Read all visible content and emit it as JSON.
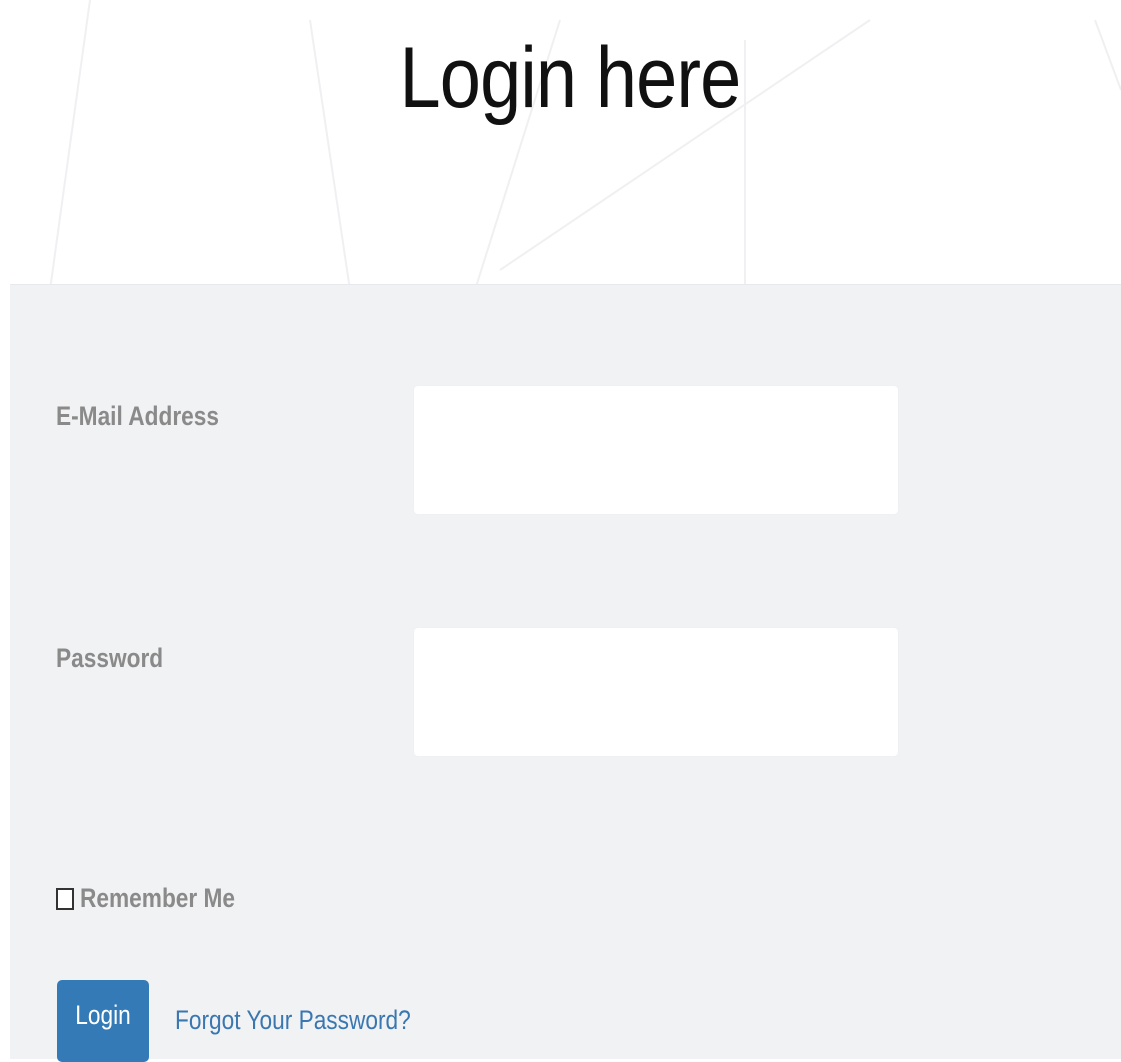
{
  "page": {
    "title": "Login here"
  },
  "form": {
    "email_label": "E-Mail Address",
    "email_value": "",
    "password_label": "Password",
    "password_value": "",
    "remember_label": "Remember Me",
    "remember_checked": false,
    "login_label": "Login",
    "forgot_label": "Forgot Your Password?"
  },
  "colors": {
    "panel_background": "#f1f2f4",
    "button_primary": "#337ab7",
    "link": "#3a77b0",
    "label_text": "#8a8a8a"
  }
}
